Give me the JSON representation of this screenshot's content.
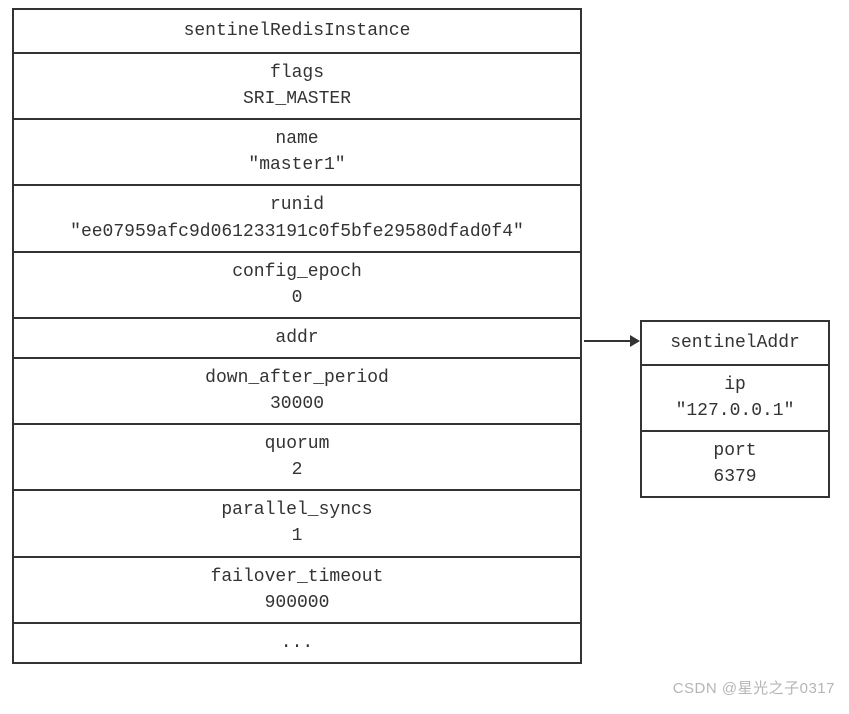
{
  "left": {
    "title": "sentinelRedisInstance",
    "fields": [
      {
        "label": "flags",
        "value": "SRI_MASTER"
      },
      {
        "label": "name",
        "value": "\"master1\""
      },
      {
        "label": "runid",
        "value": "\"ee07959afc9d061233191c0f5bfe29580dfad0f4\""
      },
      {
        "label": "config_epoch",
        "value": "0"
      },
      {
        "label": "addr",
        "value": ""
      },
      {
        "label": "down_after_period",
        "value": "30000"
      },
      {
        "label": "quorum",
        "value": "2"
      },
      {
        "label": "parallel_syncs",
        "value": "1"
      },
      {
        "label": "failover_timeout",
        "value": "900000"
      },
      {
        "label": "...",
        "value": ""
      }
    ]
  },
  "right": {
    "title": "sentinelAddr",
    "fields": [
      {
        "label": "ip",
        "value": "\"127.0.0.1\""
      },
      {
        "label": "port",
        "value": "6379"
      }
    ]
  },
  "watermark": "CSDN @星光之子0317"
}
